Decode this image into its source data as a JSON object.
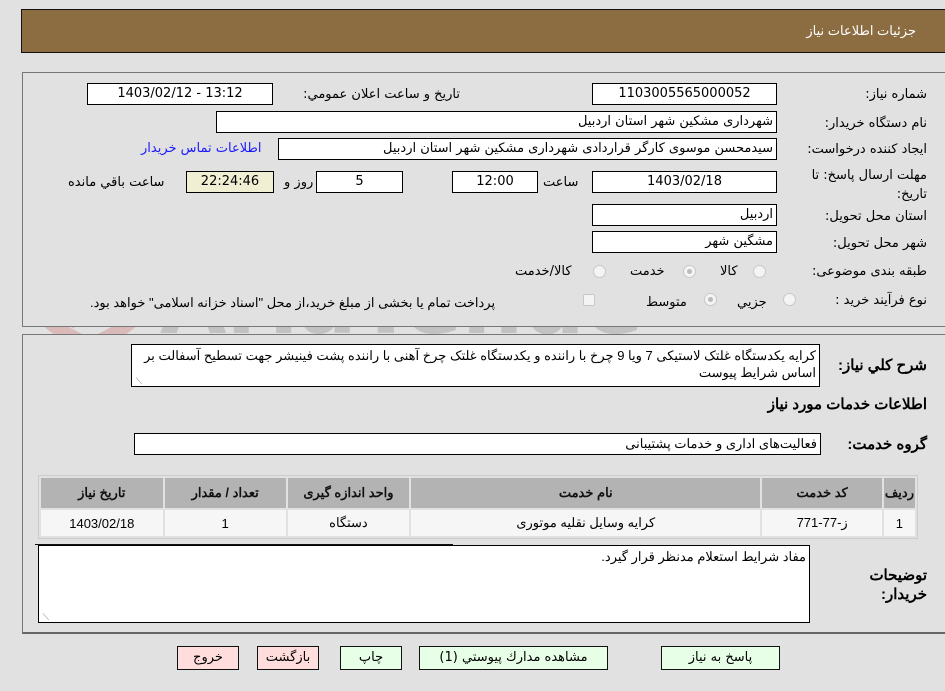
{
  "header": {
    "title": "جزئيات اطلاعات نياز"
  },
  "fields": {
    "need_number_label": "شماره نياز:",
    "need_number": "1103005565000052",
    "announce_label": "تاريخ و ساعت اعلان عمومي:",
    "announce_value": "1403/02/12 - 13:12",
    "buyer_org_label": "نام دستگاه خريدار:",
    "buyer_org": "شهرداری مشکین شهر استان اردبیل",
    "requester_label": "ايجاد كننده درخواست:",
    "requester": "سیدمحسن موسوی کارگر قراردادی شهرداری مشکین شهر استان اردبیل",
    "buyer_contact_link": "اطلاعات تماس خريدار",
    "deadline_label": "مهلت ارسال پاسخ: تا تاريخ:",
    "deadline_date": "1403/02/18",
    "time_label": "ساعت",
    "deadline_time": "12:00",
    "days_value": "5",
    "days_label": "روز و",
    "remaining_time": "22:24:46",
    "remaining_label": "ساعت باقي مانده",
    "province_label": "استان محل تحويل:",
    "province": "اردبیل",
    "city_label": "شهر محل تحويل:",
    "city": "مشگین شهر",
    "category_label": "طبقه بندی موضوعی:",
    "category_options": [
      {
        "label": "كالا",
        "checked": false
      },
      {
        "label": "خدمت",
        "checked": true
      },
      {
        "label": "كالا/خدمت",
        "checked": false
      }
    ],
    "process_label": "نوع فرآيند خريد :",
    "process_options": [
      {
        "label": "جزيي",
        "checked": false
      },
      {
        "label": "متوسط",
        "checked": true
      }
    ],
    "treasury_note": "پرداخت تمام يا بخشی از مبلغ خريد،از محل \"اسناد خزانه اسلامی\" خواهد بود.",
    "treasury_checked": false
  },
  "description": {
    "label": "شرح كلي نياز:",
    "text": "کرایه یکدستگاه غلتک لاستیکی 7 ویا 9 چرخ با راننده و یکدستگاه غلتک چرخ آهنی با راننده پشت فینیشر جهت تسطیح آسفالت بر اساس شرایط پیوست"
  },
  "services": {
    "section_title": "اطلاعات خدمات مورد نياز",
    "group_label": "گروه خدمت:",
    "group_value": "فعالیت‌های اداری و خدمات پشتیبانی",
    "columns": [
      "رديف",
      "كد خدمت",
      "نام خدمت",
      "واحد اندازه گيری",
      "تعداد / مقدار",
      "تاريخ نياز"
    ],
    "rows": [
      [
        "1",
        "ز-77-771",
        "کرایه وسایل نقلیه موتوری",
        "دستگاه",
        "1",
        "1403/02/18"
      ]
    ]
  },
  "buyer_notes": {
    "label": "توضيحات خريدار:",
    "text": "مفاد شرایط استعلام مدنظر قرار گیرد."
  },
  "buttons": {
    "reply": "پاسخ به نياز",
    "attachments": "مشاهده مدارك پيوستي (1)",
    "print": "چاپ",
    "back": "بازگشت",
    "exit": "خروج"
  },
  "colors": {
    "header_bg": "#8c6d42",
    "green_button": "#e6ffe6",
    "pink_button": "#ffdddd",
    "timer_bg": "#f0efd3",
    "link": "#1a1aff"
  }
}
